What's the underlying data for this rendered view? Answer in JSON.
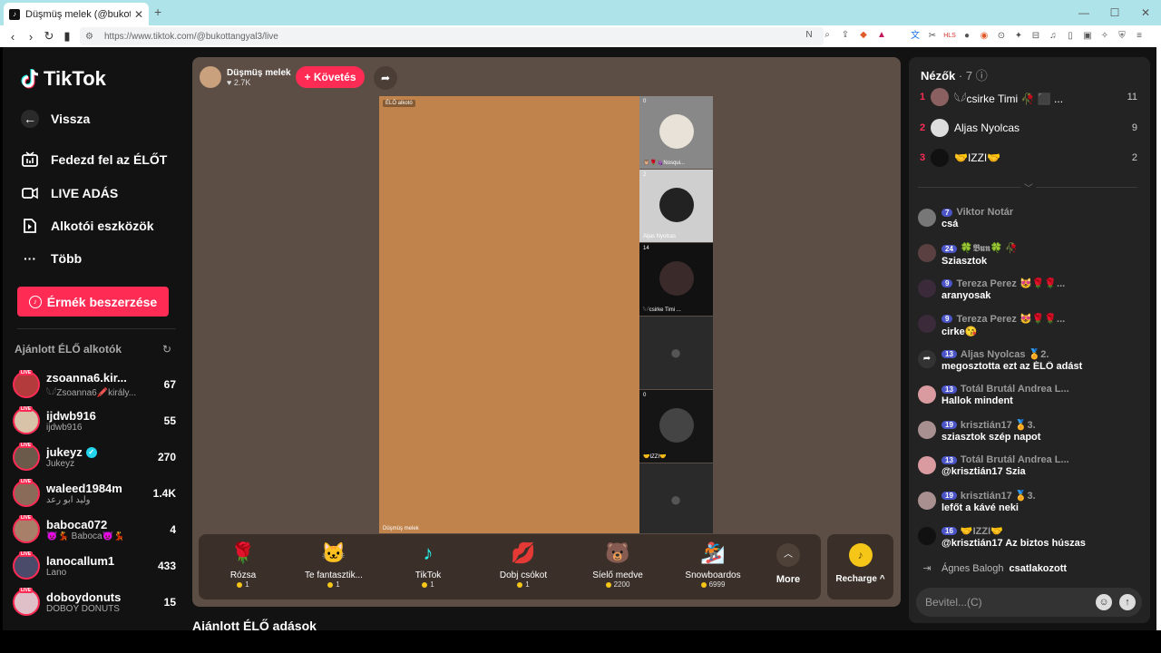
{
  "browser": {
    "tab_title": "Düşmüş melek (@bukottangyal3",
    "url": "https://www.tiktok.com/@bukottangyal3/live",
    "window_controls": [
      "—",
      "☐",
      "✕"
    ]
  },
  "sidebar": {
    "logo": "TikTok",
    "back": "Vissza",
    "nav": [
      "Fedezd fel az ÉLŐT",
      "LIVE ADÁS",
      "Alkotói eszközök",
      "Több"
    ],
    "coins_button": "Érmék beszerzése",
    "recommended_title": "Ajánlott ÉLŐ alkotók",
    "creators": [
      {
        "name": "zsoanna6.kir...",
        "sub": "𓆩𓆪Zsoanna6🖍️király...",
        "count": "67",
        "live": "LIVE",
        "color": "#b33b3b"
      },
      {
        "name": "ijdwb916",
        "sub": "ijdwb916",
        "count": "55",
        "live": "LIVE",
        "color": "#d8c2a8"
      },
      {
        "name": "jukeyz",
        "sub": "Jukeyz",
        "count": "270",
        "live": "LIVE",
        "color": "#6b5a4a",
        "verified": true
      },
      {
        "name": "waleed1984m",
        "sub": "وليد ابو رعد",
        "count": "1.4K",
        "live": "LIVE",
        "color": "#8a6b5a"
      },
      {
        "name": "baboca072",
        "sub": "😈💃 Baboca😈💃",
        "count": "4",
        "live": "LIVE",
        "color": "#a8806a"
      },
      {
        "name": "lanocallum1",
        "sub": "Lano",
        "count": "433",
        "live": "LIVE",
        "color": "#4a4a6a"
      },
      {
        "name": "doboydonuts",
        "sub": "DOBOY DONUTS",
        "count": "15",
        "live": "LIVE",
        "color": "#e0c0c8"
      }
    ]
  },
  "stage": {
    "host_name": "Düşmüş melek",
    "host_likes": "♥ 2.7K",
    "follow_label": "+ Követés",
    "main_tag": "ÉLŐ alkotó",
    "main_owner": "Düşmüş melek",
    "guests": [
      {
        "count": "0",
        "name": "🦉🌹🍇Nosqui..."
      },
      {
        "count": "2",
        "name": "Aljas Nyolcas"
      },
      {
        "count": "14",
        "name": "𓆩𓆪csirke Timi ..."
      },
      {
        "count": "",
        "name": ""
      },
      {
        "count": "0",
        "name": "🤝IZZI🤝"
      },
      {
        "count": "",
        "name": ""
      }
    ],
    "gifts": [
      {
        "icon": "🌹",
        "name": "Rózsa",
        "price": "1"
      },
      {
        "icon": "🐱",
        "name": "Te fantasztik...",
        "price": "1"
      },
      {
        "icon": "♪",
        "name": "TikTok",
        "price": "1"
      },
      {
        "icon": "💋",
        "name": "Dobj csókot",
        "price": "1"
      },
      {
        "icon": "🐻",
        "name": "Síelő medve",
        "price": "2200"
      },
      {
        "icon": "🏂",
        "name": "Snowboardos",
        "price": "6999"
      }
    ],
    "more_label": "More",
    "recharge_label": "Recharge ^",
    "recommended_live": "Ajánlott ÉLŐ adások"
  },
  "chat": {
    "viewers_title": "Nézők",
    "viewers_count": "· 7",
    "viewers": [
      {
        "rank": "1",
        "name": "𓆩𓆪csirke Timi 🥀 ⬛ ...",
        "score": "11"
      },
      {
        "rank": "2",
        "name": "Aljas Nyolcas",
        "score": "9"
      },
      {
        "rank": "3",
        "name": "🤝IZZI🤝",
        "score": "2"
      }
    ],
    "messages": [
      {
        "level": "7",
        "user": "Viktor Notár",
        "text": "csá"
      },
      {
        "level": "24",
        "user": "🍀𝕭𝖚𝖓🍀 🥀",
        "text": "Sziasztok"
      },
      {
        "level": "9",
        "user": "Tereza Perez 😻🌹🌹...",
        "text": "aranyosak"
      },
      {
        "level": "9",
        "user": "Tereza Perez 😻🌹🌹...",
        "text": "cirke😘"
      },
      {
        "level": "13",
        "user": "Aljas Nyolcas 🏅2.",
        "text": "megosztotta ezt az ÉLŐ adást"
      },
      {
        "level": "13",
        "user": "Totál Brutál Andrea L...",
        "text": "Hallok mindent"
      },
      {
        "level": "19",
        "user": "krisztián17 🏅3.",
        "text": "sziasztok szép napot"
      },
      {
        "level": "13",
        "user": "Totál Brutál Andrea L...",
        "text": "@krisztián17 Szia"
      },
      {
        "level": "19",
        "user": "krisztián17 🏅3.",
        "text": "lefőt a kávé neki"
      },
      {
        "level": "16",
        "user": "🤝IZZI🤝",
        "text": "@krisztián17 Az biztos húszas"
      }
    ],
    "joined_name": "Ágnes Balogh",
    "joined_text": "csatlakozott",
    "input_placeholder": "Bevitel...(C)"
  }
}
